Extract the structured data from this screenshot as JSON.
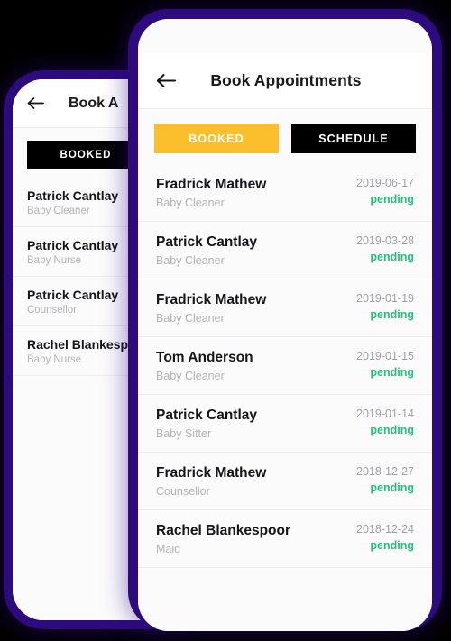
{
  "theme": {
    "frame_color": "#2d0a7d",
    "page_background": "#000000",
    "screen_background": "#fbfbfc",
    "accent_yellow": "#fbbf2e",
    "accent_black": "#000000",
    "status_green": "#24bf7b",
    "muted_text": "#b3b3b8",
    "date_text": "#a0a0a6"
  },
  "front_phone": {
    "appbar": {
      "back_icon": "arrow-left-icon",
      "title": "Book Appointments"
    },
    "tabs": [
      {
        "label": "BOOKED",
        "state": "active"
      },
      {
        "label": "SCHEDULE",
        "state": "inactive"
      }
    ],
    "appointments": [
      {
        "name": "Fradrick Mathew",
        "role": "Baby Cleaner",
        "date": "2019-06-17",
        "status": "pending"
      },
      {
        "name": "Patrick Cantlay",
        "role": "Baby Cleaner",
        "date": "2019-03-28",
        "status": "pending"
      },
      {
        "name": "Fradrick Mathew",
        "role": "Baby Cleaner",
        "date": "2019-01-19",
        "status": "pending"
      },
      {
        "name": "Tom Anderson",
        "role": "Baby Cleaner",
        "date": "2019-01-15",
        "status": "pending"
      },
      {
        "name": "Patrick Cantlay",
        "role": "Baby Sitter",
        "date": "2019-01-14",
        "status": "pending"
      },
      {
        "name": "Fradrick Mathew",
        "role": "Counsellor",
        "date": "2018-12-27",
        "status": "pending"
      },
      {
        "name": "Rachel Blankespoor",
        "role": "Maid",
        "date": "2018-12-24",
        "status": "pending"
      }
    ]
  },
  "back_phone": {
    "appbar": {
      "back_icon": "arrow-left-icon",
      "title": "Book A"
    },
    "tabs": [
      {
        "label": "BOOKED",
        "state": "inactive-dark"
      }
    ],
    "appointments": [
      {
        "name": "Patrick Cantlay",
        "role": "Baby Cleaner"
      },
      {
        "name": "Patrick Cantlay",
        "role": "Baby Nurse"
      },
      {
        "name": "Patrick Cantlay",
        "role": "Counsellor"
      },
      {
        "name": "Rachel Blankespoor",
        "role": "Baby Nurse"
      }
    ]
  }
}
